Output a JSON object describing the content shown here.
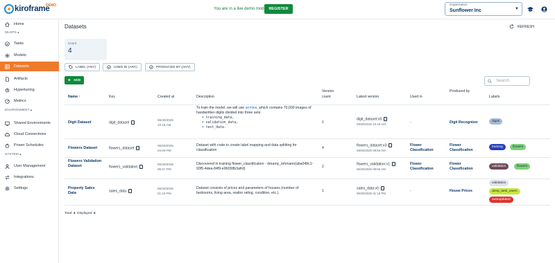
{
  "brand": {
    "name": "kiroframe",
    "badge": "DEMO"
  },
  "topbar": {
    "demo_message": "You are in a live demo mode",
    "register_label": "REGISTER",
    "organization_label": "Organization",
    "organization_value": "Sunflower Inc"
  },
  "sidebar": {
    "items": [
      {
        "label": "Home",
        "icon": "home-icon"
      },
      {
        "section": "MLOPS"
      },
      {
        "label": "Tasks",
        "icon": "tasks-icon"
      },
      {
        "label": "Models",
        "icon": "models-icon"
      },
      {
        "label": "Datasets",
        "icon": "datasets-icon",
        "active": true
      },
      {
        "label": "Artifacts",
        "icon": "artifacts-icon"
      },
      {
        "label": "Hypertuning",
        "icon": "hypertuning-icon"
      },
      {
        "label": "Metrics",
        "icon": "metrics-icon"
      },
      {
        "section": "ENVIRONMENT"
      },
      {
        "label": "Shared Environments",
        "icon": "shared-environments-icon"
      },
      {
        "label": "Cloud Connections",
        "icon": "cloud-connections-icon"
      },
      {
        "label": "Power Schedules",
        "icon": "power-schedules-icon"
      },
      {
        "section": "SYSTEM"
      },
      {
        "label": "User Management",
        "icon": "user-management-icon"
      },
      {
        "label": "Integrations",
        "icon": "integrations-icon"
      },
      {
        "label": "Settings",
        "icon": "settings-icon"
      }
    ]
  },
  "page": {
    "title": "Datasets",
    "refresh_label": "REFRESH",
    "count_label": "Count",
    "count_value": "4",
    "filters": [
      "LABEL (ANY)",
      "USED IN (ANY)",
      "PRODUCED BY (ANY)"
    ],
    "add_label": "ADD",
    "search_placeholder": "Search"
  },
  "table": {
    "headers": {
      "name": "Name",
      "key": "Key",
      "created_at": "Created at",
      "description": "Description",
      "version_count": "Version count",
      "latest_version": "Latest version",
      "used_in": "Used in",
      "produced_by": "Produced by",
      "labels": "Labels"
    },
    "rows": [
      {
        "name": "Digit Dataset",
        "key": "digit_dataset",
        "created_date": "06/30/2025",
        "created_time": "10:18 AM",
        "description_prefix": "To train the model, we will use ",
        "description_link": "archive",
        "description_suffix": ", which contains 70,000 images of handwritten digits divided into three sets:",
        "description_list": [
          "training_data,",
          "validation_data,",
          "test_data."
        ],
        "version_count": "1",
        "latest_version": "digit_dataset:v0",
        "latest_version_date": "06/30/2025 10:18 AM",
        "used_in": "-",
        "produced_by": "Digit Recognizer",
        "labels": [
          {
            "text": "digits",
            "bg": "#a8bcd0",
            "fg": "#0d3a6a"
          }
        ]
      },
      {
        "name": "Flowers Dataset",
        "key": "flowers_dataset",
        "created_date": "06/29/2025",
        "created_time": "04:09 PM",
        "description": "Dataset with code to create label mapping and data splitting for classification",
        "version_count": "4",
        "latest_version": "flowers_dataset:v3",
        "latest_version_date": "06/30/2025 09:56 AM",
        "used_in": "Flower Classification",
        "produced_by": "Flower Classification",
        "labels": [
          {
            "text": "training",
            "bg": "#2a3fb8",
            "fg": "#ffffff"
          },
          {
            "text": "flowers",
            "bg": "#7ed07a",
            "fg": "#1f2d3d"
          }
        ]
      },
      {
        "name": "Flowers Validation Dataset",
        "key": "flowers_validation",
        "created_date": "06/29/2025",
        "created_time": "06:57 PM",
        "description": "Discovered in training flower_classification - dreamy_lehmann(aba048c1-93f5-4dea-84f9-e96058b3afrd)",
        "version_count": "2",
        "latest_version": "flowers_validation:v1",
        "latest_version_date": "06/30/2025 09:56 AM",
        "used_in": "Flower Classification",
        "produced_by": "Flower Classification",
        "labels": [
          {
            "text": "validation",
            "bg": "#6e4a5a",
            "fg": "#ffffff"
          },
          {
            "text": "flowers",
            "bg": "#7ed07a",
            "fg": "#1f2d3d"
          }
        ]
      },
      {
        "name": "Property Sales Data",
        "key": "sales_data",
        "created_date": "06/30/2025",
        "created_time": "01:19 PM",
        "description": "Dataset consists of prices and parameters of houses (number of bedrooms, living area, realtor rating, condition, etc.).",
        "version_count": "1",
        "latest_version": "sales_data:v0",
        "latest_version_date": "06/30/2025 01:19 PM",
        "used_in": "-",
        "produced_by": "House Prices",
        "labels": [
          {
            "text": "validation",
            "bg": "#dfe3e8",
            "fg": "#1f2d3d"
          },
          {
            "text": "deep_task_users",
            "bg": "#c6e83a",
            "fg": "#1f2d3d"
          },
          {
            "text": "autoupdated",
            "bg": "#e0322e",
            "fg": "#ffffff"
          }
        ]
      }
    ]
  },
  "footer": {
    "total_label": "Total:",
    "total_value": "4",
    "displayed_label": "Displayed:",
    "displayed_value": "4"
  },
  "colors": {
    "accent": "#ee7a2c",
    "primary": "#0f8a3c",
    "navy": "#0d3a6a"
  }
}
